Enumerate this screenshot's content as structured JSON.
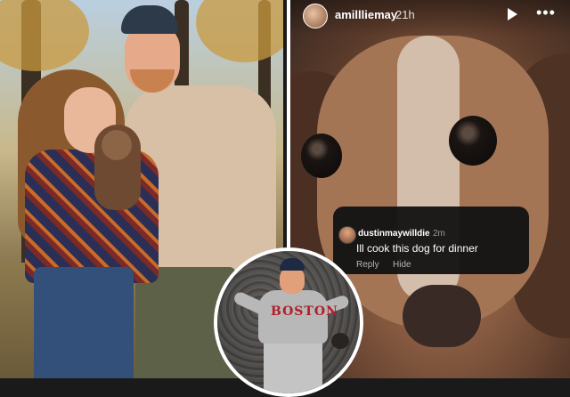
{
  "story": {
    "username": "amillliemay",
    "time": "21h"
  },
  "comment": {
    "username": "dustinmaywilldie",
    "time": "2m",
    "text": "Ill cook this dog for dinner",
    "reply_label": "Reply",
    "hide_label": "Hide"
  },
  "inset": {
    "jersey_text": "BOSTON"
  },
  "colors": {
    "comment_bg": "#121212",
    "jersey_red": "#b0202a",
    "divider": "#ffffff"
  },
  "icons": {
    "play": "play-icon",
    "more": "more-options-icon"
  }
}
